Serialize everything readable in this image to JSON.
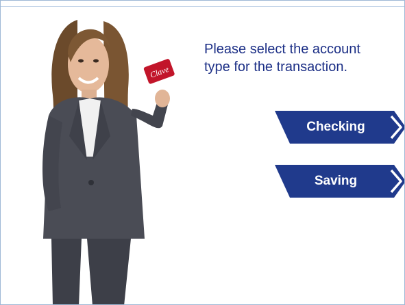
{
  "prompt": {
    "line1": "Please select the account",
    "line2": "type for the transaction."
  },
  "buttons": {
    "checking": "Checking",
    "saving": "Saving"
  },
  "card": {
    "brand": "Clave"
  },
  "colors": {
    "prompt_text": "#1c2f86",
    "button_fill": "#203a8c",
    "arrow": "#ffffff",
    "background": "#ffffff"
  },
  "icons": {
    "button_arrow": "chevron-right-icon"
  }
}
